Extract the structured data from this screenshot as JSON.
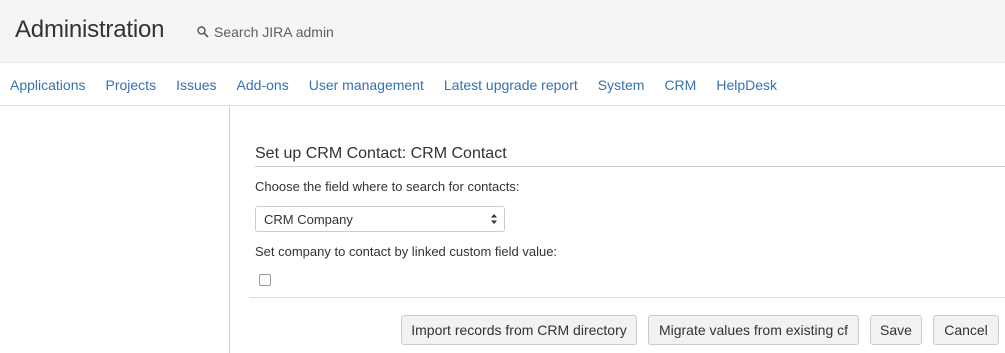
{
  "header": {
    "title": "Administration",
    "search_placeholder": "Search JIRA admin"
  },
  "nav": {
    "items": [
      "Applications",
      "Projects",
      "Issues",
      "Add-ons",
      "User management",
      "Latest upgrade report",
      "System",
      "CRM",
      "HelpDesk"
    ]
  },
  "form": {
    "title": "Set up CRM Contact: CRM Contact",
    "search_field_label": "Choose the field where to search for contacts:",
    "search_field_value": "CRM Company",
    "link_company_label": "Set company to contact by linked custom field value:",
    "link_company_checked": false
  },
  "buttons": {
    "import_label": "Import records from CRM directory",
    "migrate_label": "Migrate values from existing cf",
    "save_label": "Save",
    "cancel_label": "Cancel"
  },
  "colors": {
    "link": "#3572b0",
    "header_bg": "#f5f5f5",
    "button_bg": "#f2f2f2"
  },
  "icons": {
    "search": "search-icon",
    "select_arrows": "select-arrows-icon"
  }
}
